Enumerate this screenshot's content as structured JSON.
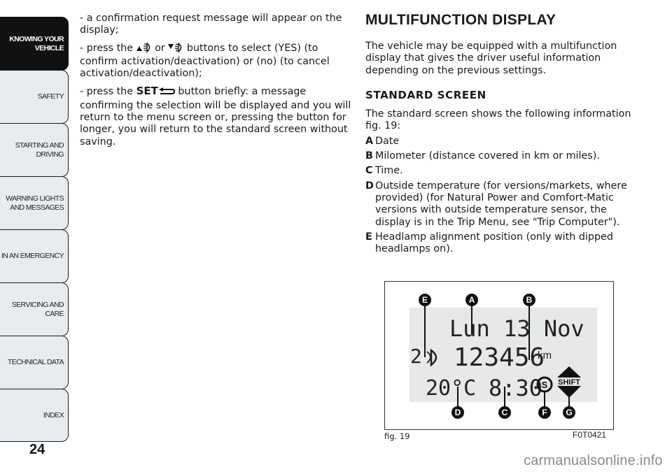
{
  "sidebar": {
    "tabs": [
      {
        "label": "KNOWING YOUR\nVEHICLE",
        "active": true
      },
      {
        "label": "SAFETY",
        "active": false
      },
      {
        "label": "STARTING AND\nDRIVING",
        "active": false
      },
      {
        "label": "WARNING LIGHTS\nAND MESSAGES",
        "active": false
      },
      {
        "label": "IN AN EMERGENCY",
        "active": false
      },
      {
        "label": "SERVICING AND\nCARE",
        "active": false
      },
      {
        "label": "TECHNICAL DATA",
        "active": false
      },
      {
        "label": "INDEX",
        "active": false
      }
    ],
    "page_number": "24"
  },
  "left_column": {
    "p1": "- a confirmation request message will appear on the display;",
    "p2_before": "- press the ",
    "p2_icon_up": "headlamp-up-icon",
    "p2_or": " or ",
    "p2_icon_down": "headlamp-down-icon",
    "p2_after": " buttons to select (YES) (to confirm activation/deactivation) or (no) (to cancel activation/deactivation);",
    "p3_before": "- press the ",
    "p3_set": "SET",
    "p3_icon": "return-arrow-icon",
    "p3_after": " button briefly: a message confirming the selection will be displayed and you will return to the menu screen or, pressing the button for longer, you will return to the standard screen without saving."
  },
  "right_column": {
    "title": "MULTIFUNCTION DISPLAY",
    "intro": "The vehicle may be equipped with a multifunction display that gives the driver useful information depending on the previous settings.",
    "subtitle": "STANDARD SCREEN",
    "lead": "The standard screen shows the following information fig. 19:",
    "items": [
      {
        "key": "A",
        "text": "Date"
      },
      {
        "key": "B",
        "text": "Milometer (distance covered in km or miles)."
      },
      {
        "key": "C",
        "text": "Time."
      },
      {
        "key": "D",
        "text": "Outside temperature (for versions/markets, where provided) (for Natural Power and Comfort-Matic versions with outside temperature sensor, the display is in the Trip Menu, see \"Trip Computer\")."
      },
      {
        "key": "E",
        "text": "Headlamp alignment position (only with dipped headlamps on)."
      }
    ]
  },
  "figure": {
    "caption": "fig. 19",
    "code": "F0T0421",
    "lcd": {
      "date": "Lun 13 Nov",
      "headlamp_level": "2",
      "odometer": "123456",
      "odometer_unit": "km",
      "temperature": "20°C",
      "time": "8:30",
      "start_stop_symbol": "S",
      "shift_label": "SHIFT"
    },
    "callouts": [
      "E",
      "A",
      "B",
      "D",
      "C",
      "F",
      "G"
    ]
  },
  "watermark": "carmanualsonline.info"
}
